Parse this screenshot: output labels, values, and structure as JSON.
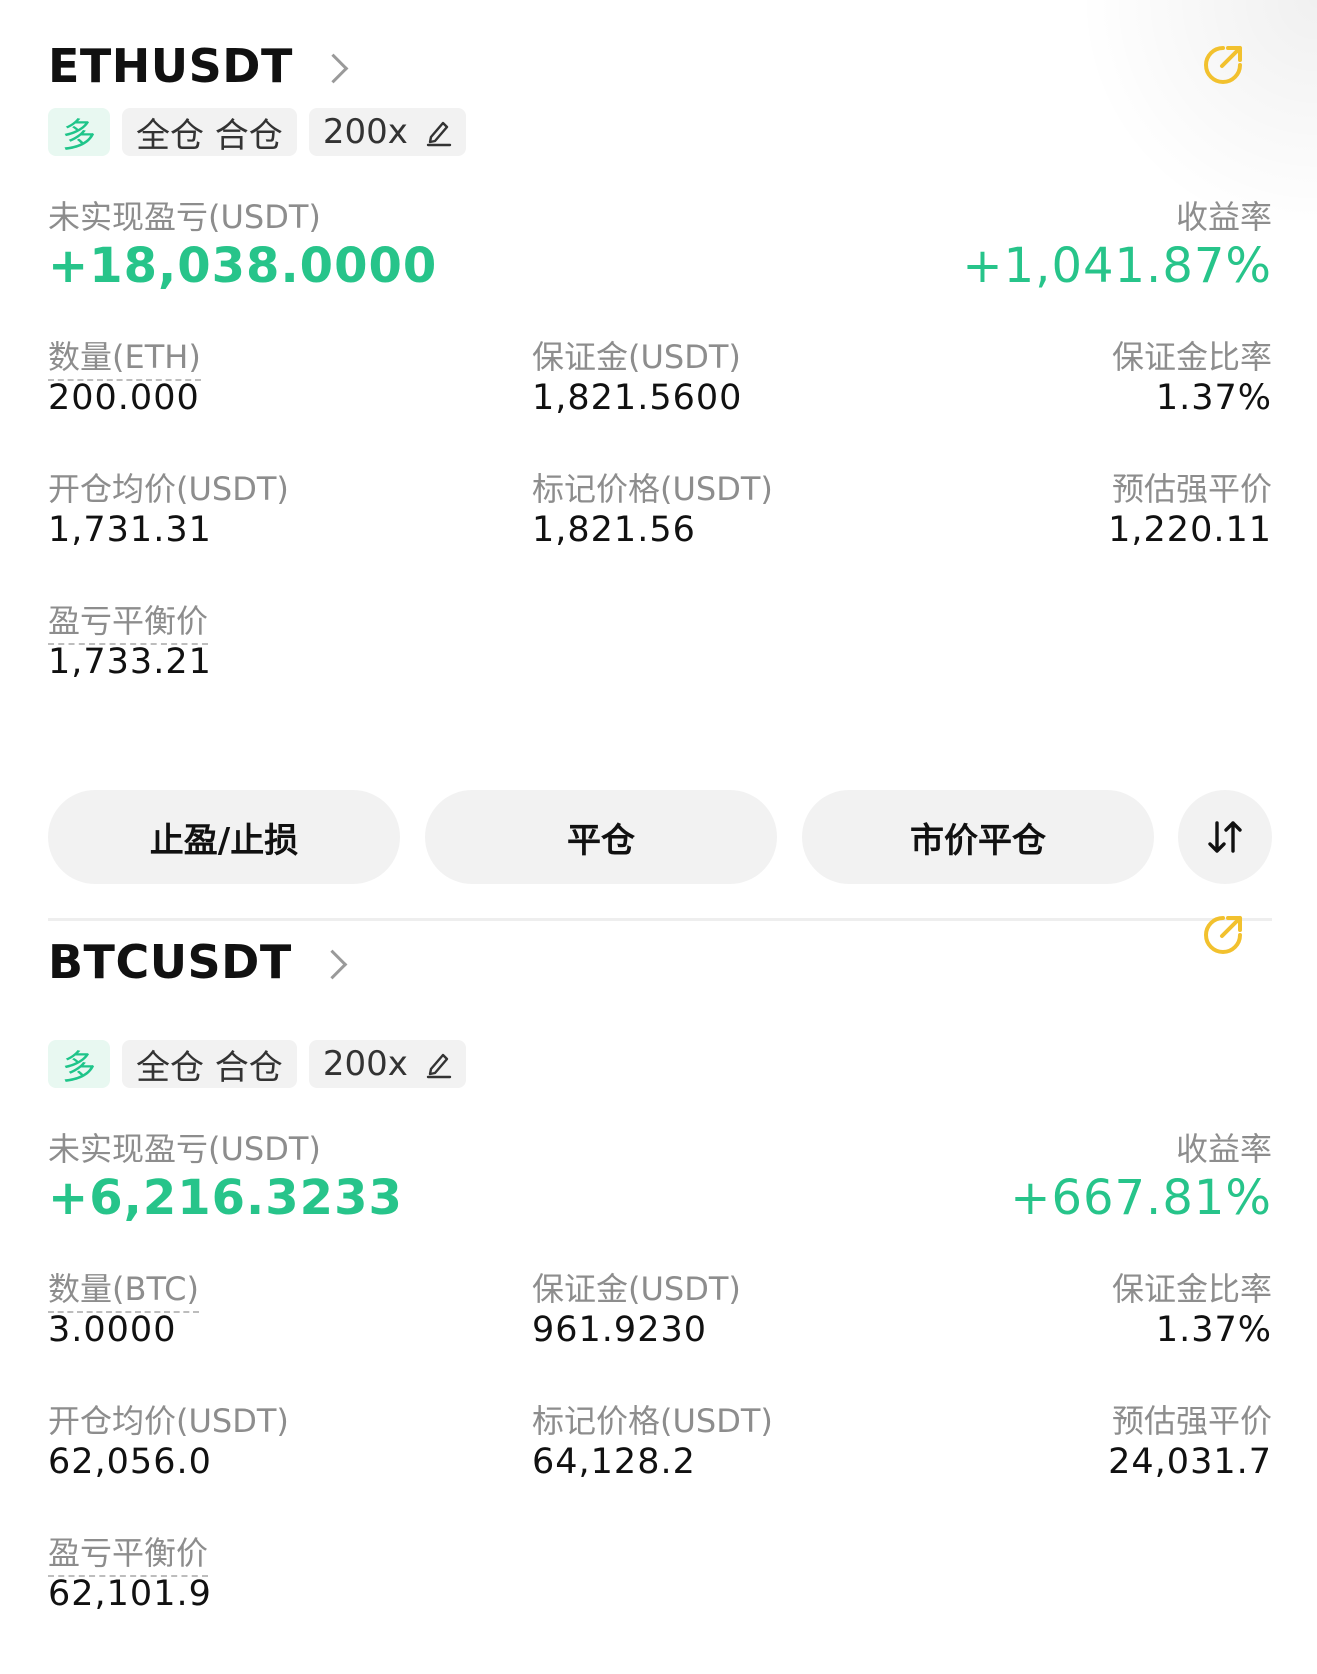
{
  "colors": {
    "profit": "#27c48a",
    "long_bg": "#e8f8f1",
    "share_icon": "#f2c12e",
    "tag_bg": "#f2f2f2",
    "label": "#8d8d8d"
  },
  "positions": [
    {
      "symbol": "ETHUSDT",
      "side": "多",
      "margin_mode": "全仓 合仓",
      "leverage": "200x",
      "pnl_label": "未实现盈亏(USDT)",
      "pnl_value": "+18,038.0000",
      "roi_label": "收益率",
      "roi_value": "+1,041.87%",
      "qty_label": "数量(ETH)",
      "qty_value": "200.000",
      "margin_label": "保证金(USDT)",
      "margin_value": "1,821.5600",
      "margin_ratio_label": "保证金比率",
      "margin_ratio_value": "1.37%",
      "entry_label": "开仓均价(USDT)",
      "entry_value": "1,731.31",
      "mark_label": "标记价格(USDT)",
      "mark_value": "1,821.56",
      "liq_label": "预估强平价",
      "liq_value": "1,220.11",
      "breakeven_label": "盈亏平衡价",
      "breakeven_value": "1,733.21",
      "buttons": {
        "tpsl": "止盈/止损",
        "close": "平仓",
        "market_close": "市价平仓"
      }
    },
    {
      "symbol": "BTCUSDT",
      "side": "多",
      "margin_mode": "全仓 合仓",
      "leverage": "200x",
      "pnl_label": "未实现盈亏(USDT)",
      "pnl_value": "+6,216.3233",
      "roi_label": "收益率",
      "roi_value": "+667.81%",
      "qty_label": "数量(BTC)",
      "qty_value": "3.0000",
      "margin_label": "保证金(USDT)",
      "margin_value": "961.9230",
      "margin_ratio_label": "保证金比率",
      "margin_ratio_value": "1.37%",
      "entry_label": "开仓均价(USDT)",
      "entry_value": "62,056.0",
      "mark_label": "标记价格(USDT)",
      "mark_value": "64,128.2",
      "liq_label": "预估强平价",
      "liq_value": "24,031.7",
      "breakeven_label": "盈亏平衡价",
      "breakeven_value": "62,101.9"
    }
  ]
}
